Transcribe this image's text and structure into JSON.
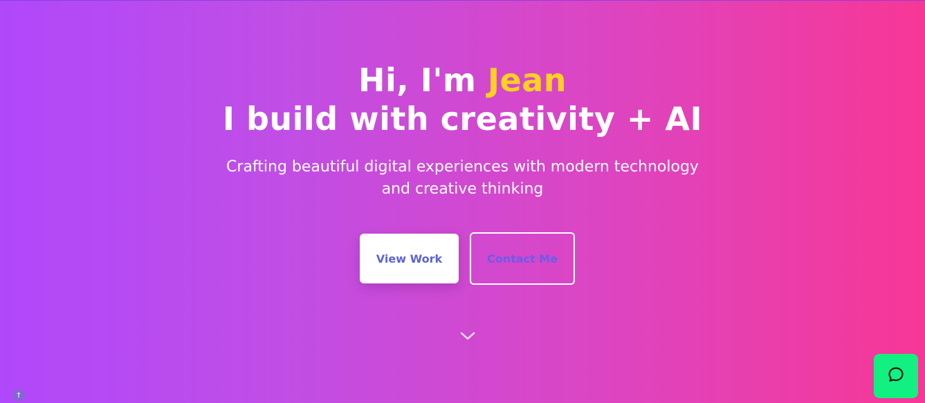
{
  "hero": {
    "greeting": "Hi, I'm ",
    "name": "Jean",
    "tagline": "I build with creativity + AI",
    "subtitle_line1": "Crafting beautiful digital experiences with modern technology",
    "subtitle_line2": "and creative thinking"
  },
  "actions": {
    "view_work_label": "View Work",
    "contact_label": "Contact Me"
  },
  "colors": {
    "gradient_start": "#b048fb",
    "gradient_end": "#f73796",
    "name_highlight": "#ffd21f",
    "chat_button": "#13f082",
    "primary_button_text": "#5b63d9"
  },
  "icons": {
    "scroll": "chevron-down-icon",
    "chat": "chat-bubble-icon",
    "corner": "dagger-icon"
  },
  "corner_badge_glyph": "†"
}
